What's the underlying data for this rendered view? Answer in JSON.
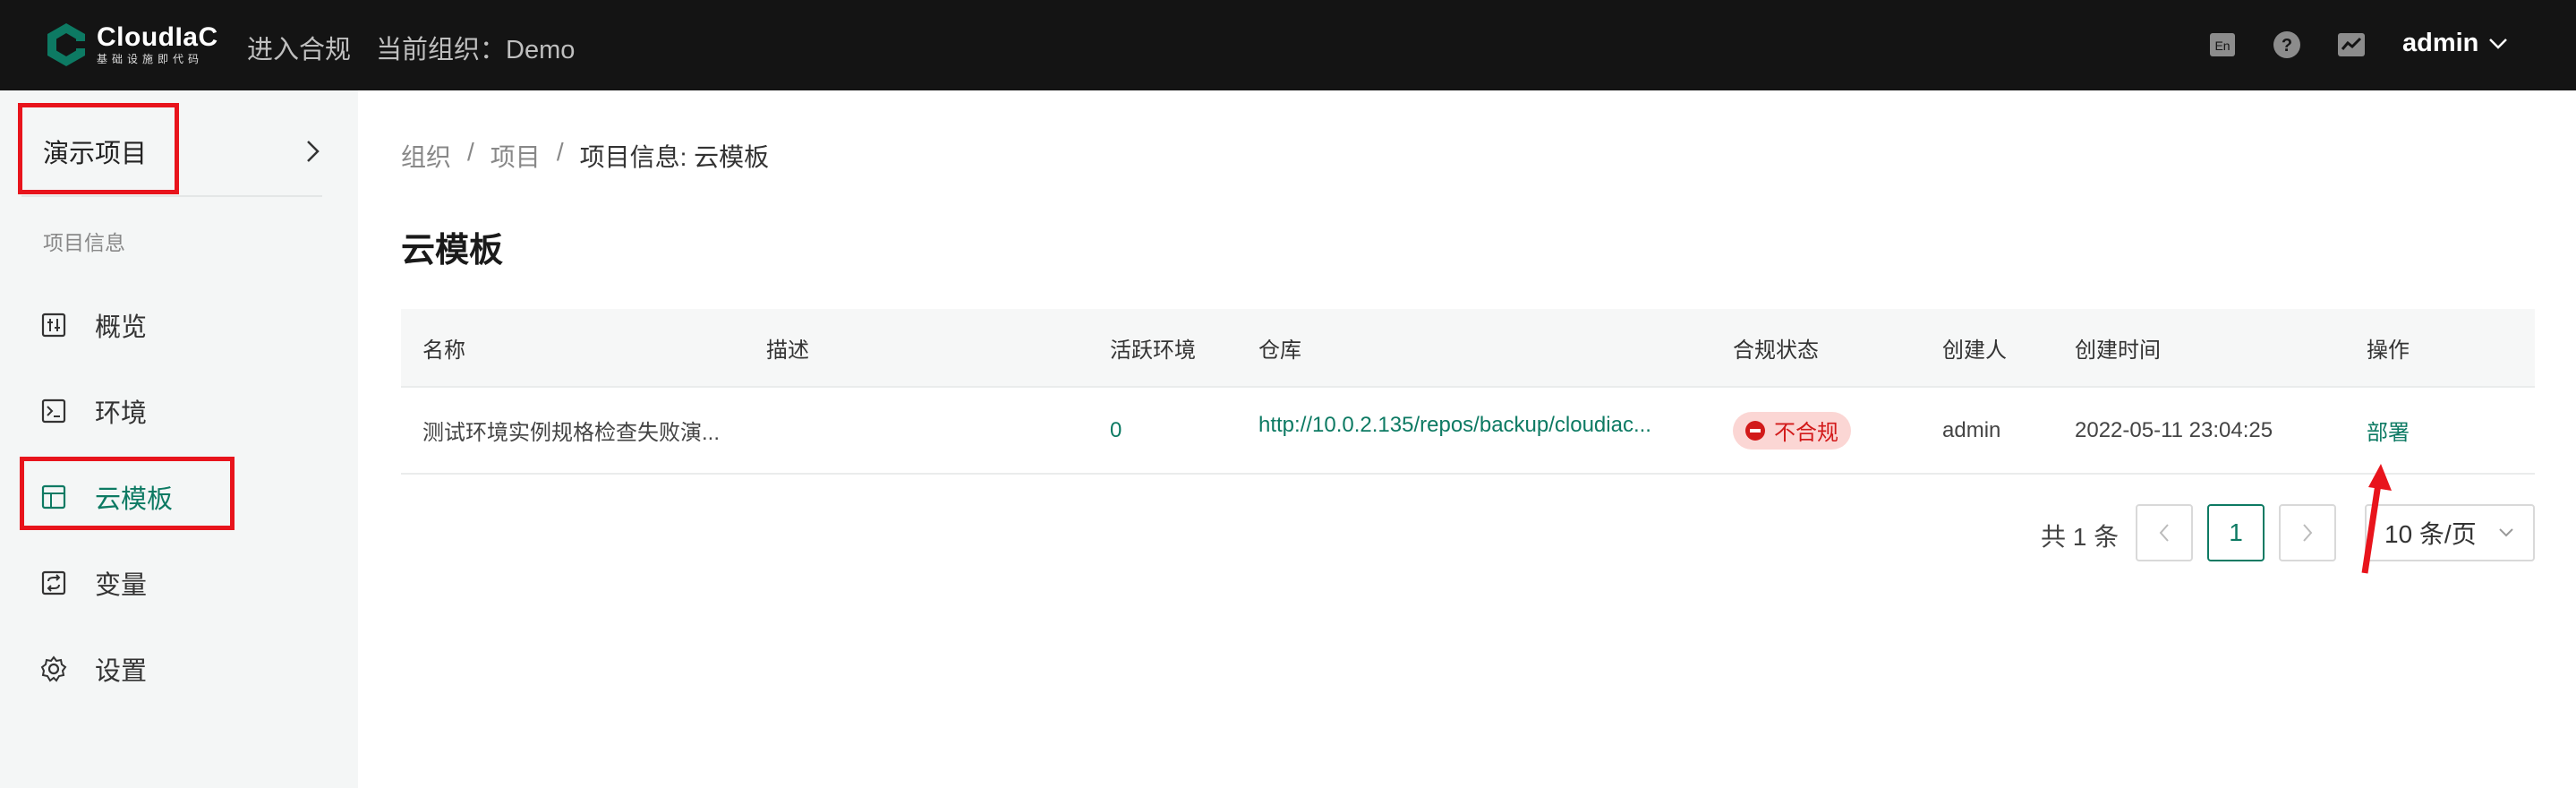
{
  "header": {
    "brand": "CloudIaC",
    "brand_sub": "基础设施即代码",
    "compliance_link": "进入合规",
    "org_label": "当前组织：Demo",
    "lang_icon": "En",
    "user": "admin"
  },
  "sidebar": {
    "project_name": "演示项目",
    "section_title": "项目信息",
    "items": [
      {
        "label": "概览",
        "icon": "overview-icon"
      },
      {
        "label": "环境",
        "icon": "terminal-icon"
      },
      {
        "label": "云模板",
        "icon": "template-icon",
        "active": true
      },
      {
        "label": "变量",
        "icon": "variable-icon"
      },
      {
        "label": "设置",
        "icon": "gear-icon"
      }
    ]
  },
  "breadcrumb": [
    "组织",
    "项目",
    "项目信息: 云模板"
  ],
  "page_title": "云模板",
  "table": {
    "headers": [
      "名称",
      "描述",
      "活跃环境",
      "仓库",
      "合规状态",
      "创建人",
      "创建时间",
      "操作"
    ],
    "rows": [
      {
        "name": "测试环境实例规格检查失败演...",
        "description": "",
        "active_envs": "0",
        "repo": "http://10.0.2.135/repos/backup/cloudiac...",
        "compliance": "不合规",
        "creator": "admin",
        "created_at": "2022-05-11 23:04:25",
        "action": "部署"
      }
    ]
  },
  "pagination": {
    "total": "共 1 条",
    "current_page": "1",
    "page_size": "10 条/页"
  },
  "colors": {
    "accent": "#0d7a63",
    "header_bg": "#141414",
    "highlight": "#e8141c",
    "danger": "#d21a1a"
  }
}
